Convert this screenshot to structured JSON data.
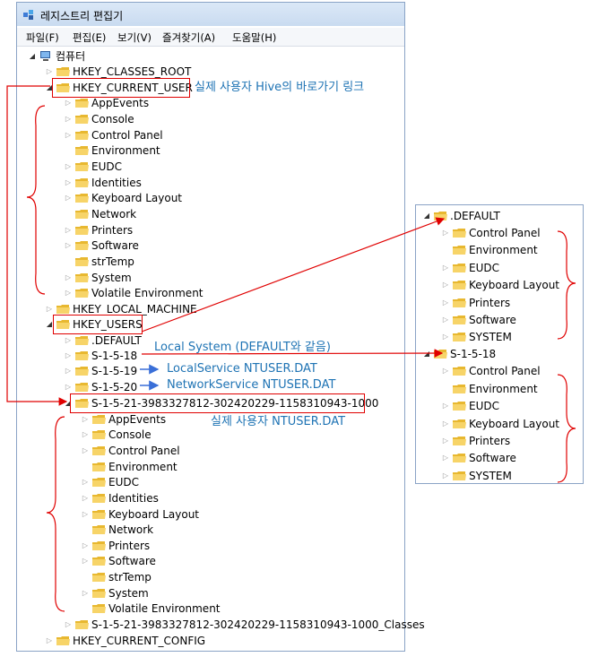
{
  "window": {
    "title": "레지스트리 편집기"
  },
  "menu": [
    "파일(F)",
    "편집(E)",
    "보기(V)",
    "즐겨찾기(A)",
    "도움말(H)"
  ],
  "root": "컴퓨터",
  "hives": {
    "classes_root": "HKEY_CLASSES_ROOT",
    "current_user": "HKEY_CURRENT_USER",
    "local_machine": "HKEY_LOCAL_MACHINE",
    "users": "HKEY_USERS",
    "current_config": "HKEY_CURRENT_CONFIG"
  },
  "hkcu_children": [
    "AppEvents",
    "Console",
    "Control Panel",
    "Environment",
    "EUDC",
    "Identities",
    "Keyboard Layout",
    "Network",
    "Printers",
    "Software",
    "strTemp",
    "System",
    "Volatile Environment"
  ],
  "users_children": {
    "default": ".DEFAULT",
    "s18": "S-1-5-18",
    "s19": "S-1-5-19",
    "s20": "S-1-5-20",
    "sid": "S-1-5-21-3983327812-302420229-1158310943-1000",
    "sid_classes": "S-1-5-21-3983327812-302420229-1158310943-1000_Classes"
  },
  "sid_children": [
    "AppEvents",
    "Console",
    "Control Panel",
    "Environment",
    "EUDC",
    "Identities",
    "Keyboard Layout",
    "Network",
    "Printers",
    "Software",
    "strTemp",
    "System",
    "Volatile Environment"
  ],
  "annotations": {
    "hkcu_note": "실제 사용자 Hive의 바로가기 링크",
    "local_system": "Local System (DEFAULT와 같음)",
    "local_service": "LocalService NTUSER.DAT",
    "network_service": "NetworkService NTUSER.DAT",
    "sid_note": "실제 사용자 NTUSER.DAT"
  },
  "panel": {
    "default_title": ".DEFAULT",
    "default_children": [
      "Control Panel",
      "Environment",
      "EUDC",
      "Keyboard Layout",
      "Printers",
      "Software",
      "SYSTEM"
    ],
    "s18_title": "S-1-5-18",
    "s18_children": [
      "Control Panel",
      "Environment",
      "EUDC",
      "Keyboard Layout",
      "Printers",
      "Software",
      "SYSTEM"
    ]
  },
  "colors": {
    "annotation": "#1e73b4",
    "highlight": "#e00000",
    "arrow_blue": "#3a6fd8",
    "folder": "#f2c94c"
  }
}
